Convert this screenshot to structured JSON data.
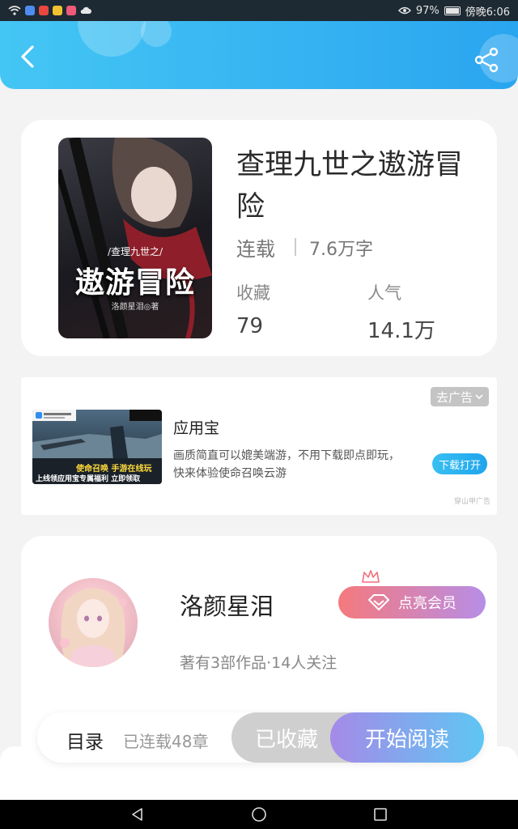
{
  "status_bar": {
    "battery_text": "97%",
    "battery_level": 0.97,
    "time": "傍晚6:06"
  },
  "header": {
    "back_icon": "chevron-left-icon",
    "share_icon": "share-icon"
  },
  "book": {
    "cover_subtitle": "/查理九世之/",
    "cover_title": "遨游冒险",
    "cover_author": "洛颜星泪◎著",
    "title": "查理九世之遨游冒险",
    "status": "连载",
    "word_count": "7.6万字",
    "favorites_label": "收藏",
    "favorites_value": "79",
    "popularity_label": "人气",
    "popularity_value": "14.1万"
  },
  "ad": {
    "close_label": "去广告",
    "image_text_1": "使命召唤 手游在线玩",
    "image_text_2": "上线领应用宝专属福利 立即领取",
    "app_name": "应用宝",
    "description": "画质简直可以媲美端游，不用下载即点即玩，快来体验使命召唤云游",
    "download_label": "下载打开",
    "source": "穿山甲广告"
  },
  "author": {
    "name": "洛颜星泪",
    "vip_label": "点亮会员",
    "meta": "著有3部作品·14人关注"
  },
  "bottom_bar": {
    "toc_label": "目录",
    "chapters": "已连载48章",
    "collect_label": "已收藏",
    "read_label": "开始阅读"
  },
  "colors": {
    "header_start": "#44c6f4",
    "header_end": "#2aa5f0",
    "vip_start": "#f5797d",
    "vip_end": "#b78ee6",
    "read_start": "#a58ae8",
    "read_end": "#5ec6f3"
  }
}
